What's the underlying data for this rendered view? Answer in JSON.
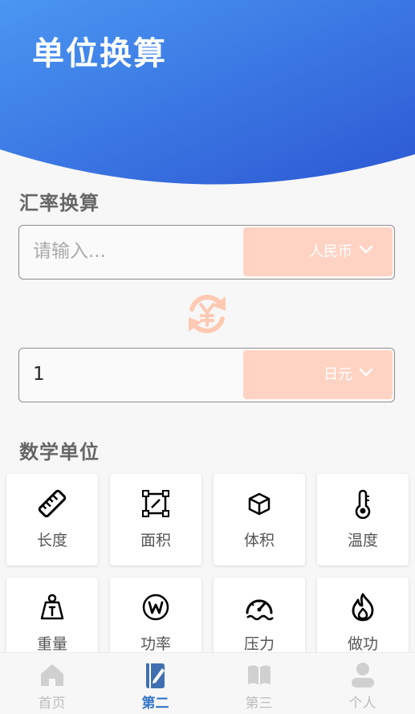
{
  "header": {
    "title": "单位换算"
  },
  "exchange": {
    "section_title": "汇率换算",
    "from": {
      "placeholder": "请输入...",
      "currency": "人民币"
    },
    "to": {
      "value": "1",
      "currency": "日元"
    }
  },
  "math": {
    "section_title": "数学单位",
    "items": [
      {
        "label": "长度",
        "icon": "ruler-icon"
      },
      {
        "label": "面积",
        "icon": "area-icon"
      },
      {
        "label": "体积",
        "icon": "cube-icon"
      },
      {
        "label": "温度",
        "icon": "thermometer-icon"
      },
      {
        "label": "重量",
        "icon": "weight-icon"
      },
      {
        "label": "功率",
        "icon": "power-icon"
      },
      {
        "label": "压力",
        "icon": "gauge-icon"
      },
      {
        "label": "做功",
        "icon": "flame-icon"
      }
    ]
  },
  "tabbar": {
    "tabs": [
      {
        "label": "首页",
        "icon": "home-icon",
        "active": false
      },
      {
        "label": "第二",
        "icon": "edit-book-icon",
        "active": true
      },
      {
        "label": "第三",
        "icon": "book-icon",
        "active": false
      },
      {
        "label": "个人",
        "icon": "user-icon",
        "active": false
      }
    ]
  },
  "colors": {
    "header_gradient_start": "#4a96f2",
    "header_gradient_end": "#2f5fd6",
    "currency_bg": "#ffd3c3",
    "swap_icon": "#ffc9b3",
    "tab_active": "#3375c5",
    "tab_inactive": "#bdbdbd"
  }
}
